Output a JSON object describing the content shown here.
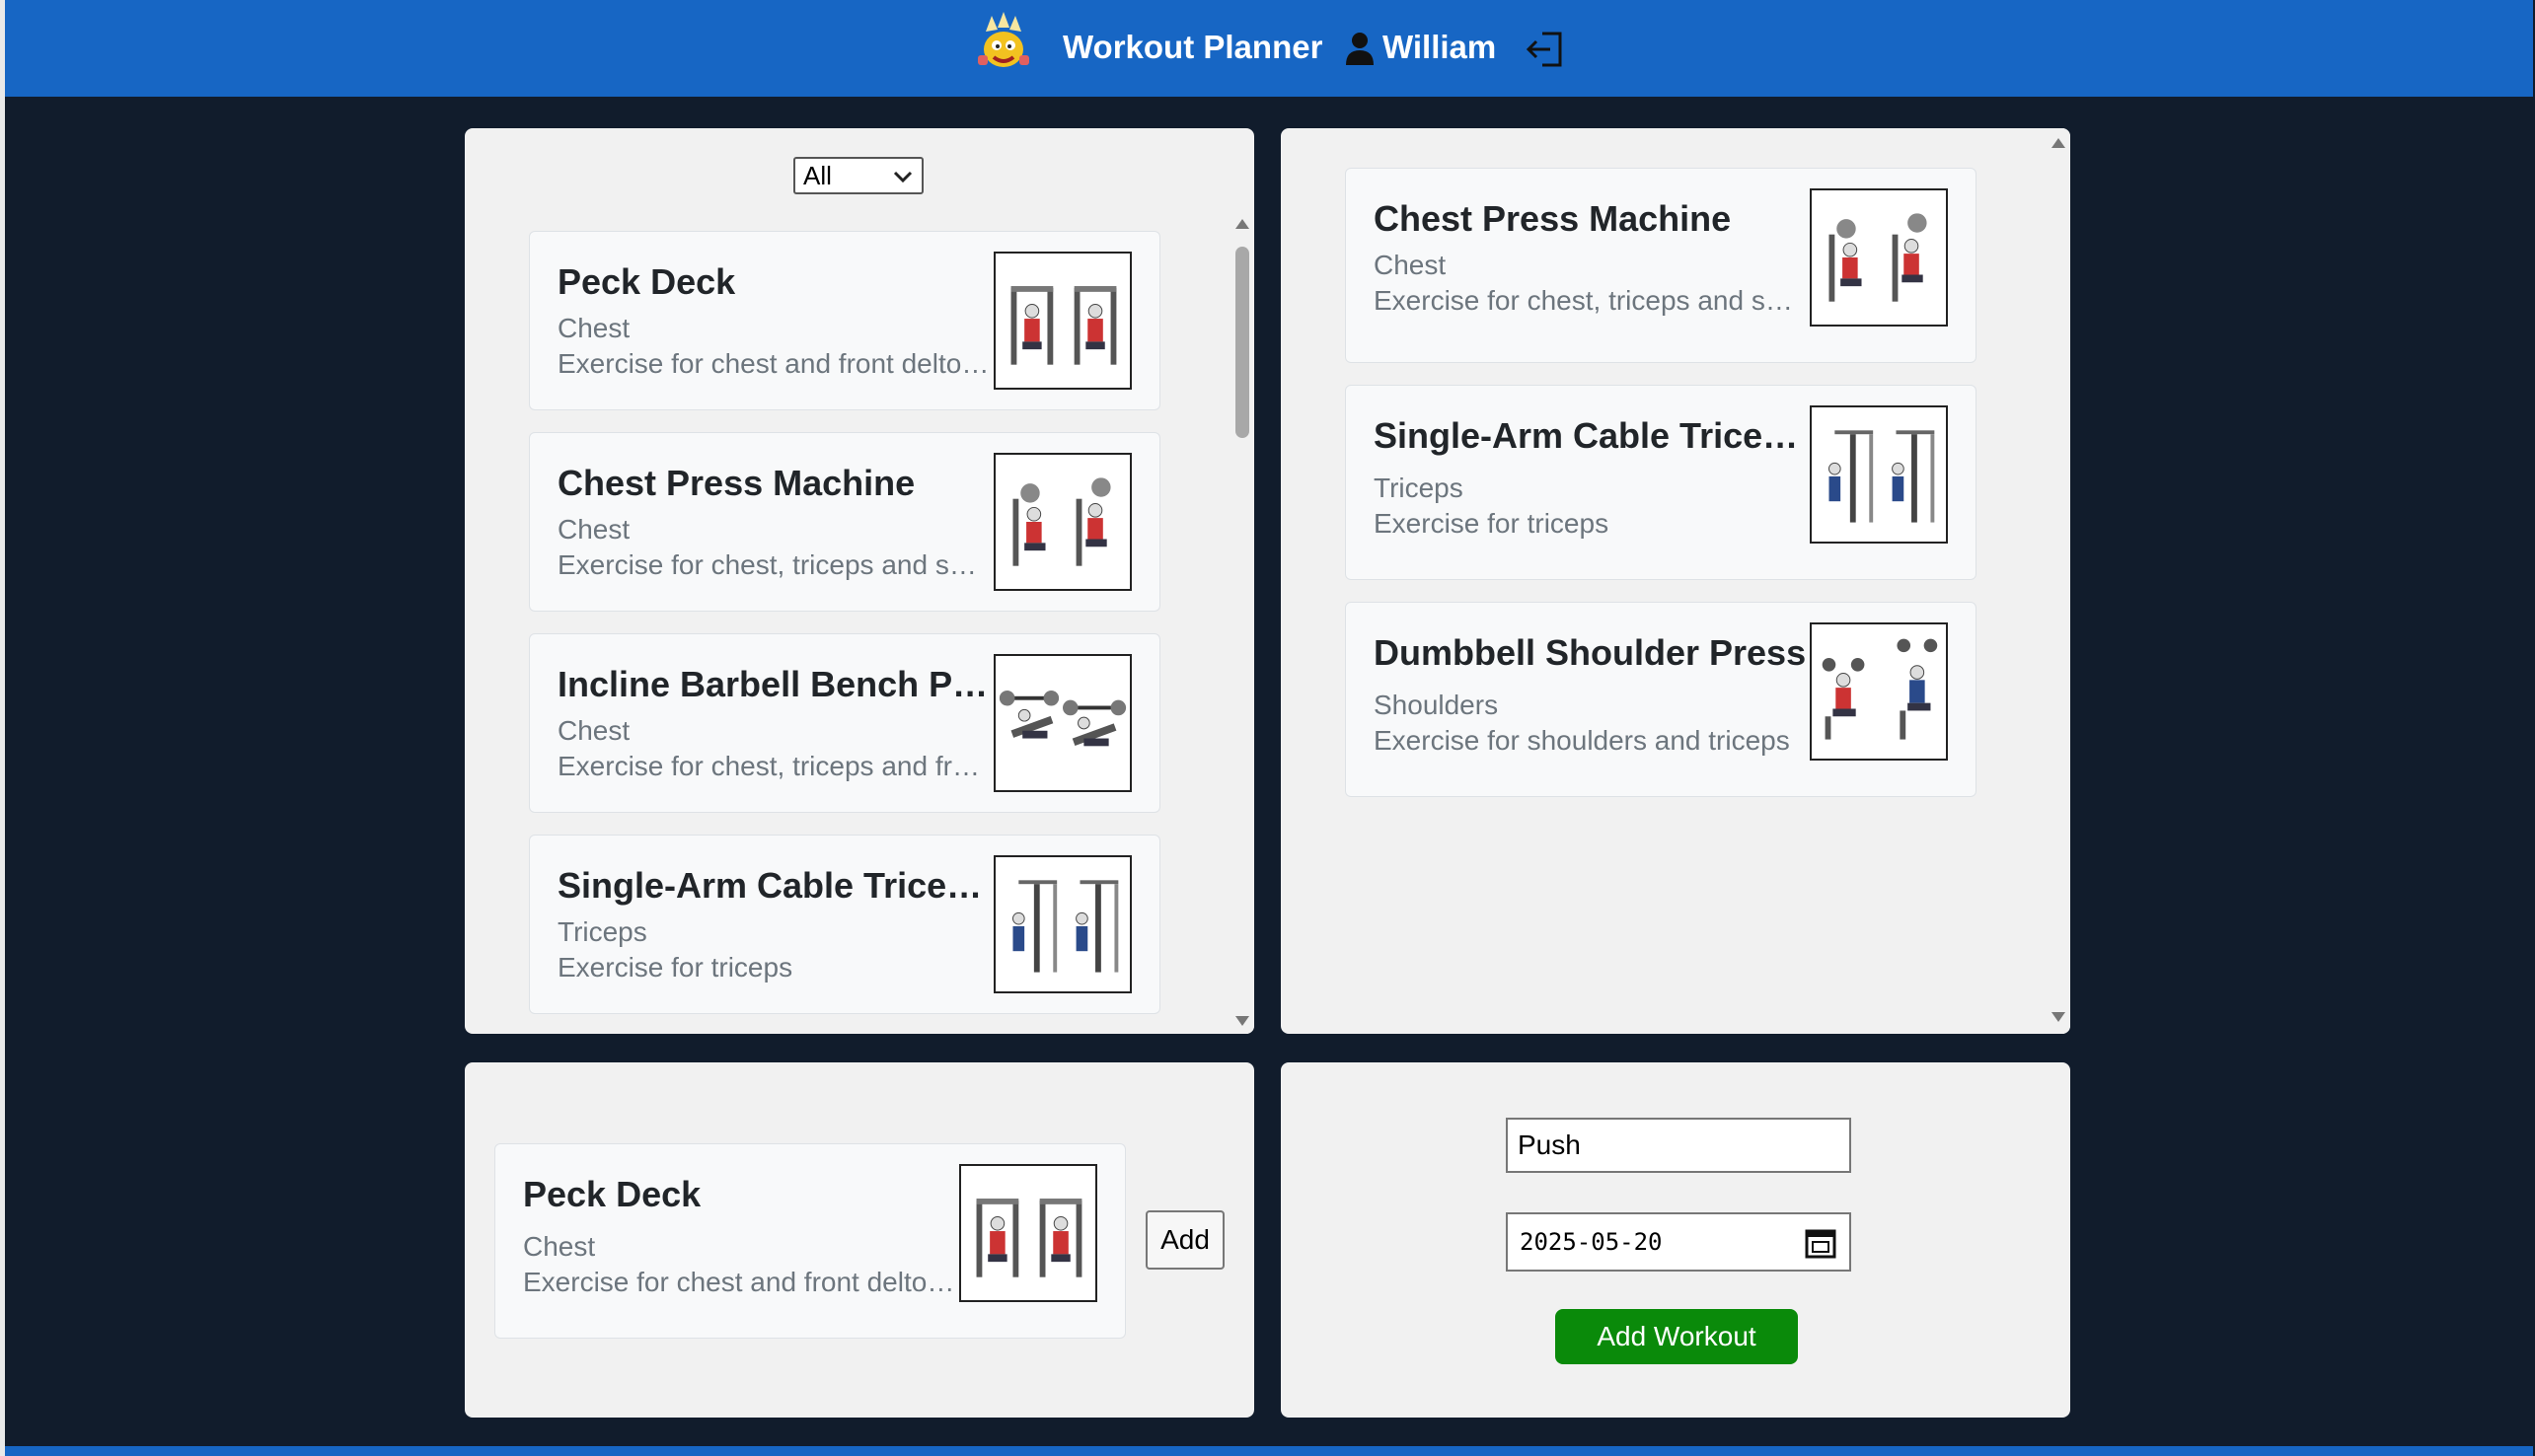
{
  "header": {
    "title": "Workout Planner",
    "user_name": "William",
    "logo_icon": "mascot-logo-icon",
    "user_icon": "user-icon",
    "logout_icon": "logout-icon"
  },
  "filter": {
    "selected": "All"
  },
  "exercise_list": [
    {
      "title": "Peck Deck",
      "category": "Chest",
      "description": "Exercise for chest and front deltoids",
      "thumbnail": "peck-deck-illustration"
    },
    {
      "title": "Chest Press Machine",
      "category": "Chest",
      "description": "Exercise for chest, triceps and shoulders",
      "thumbnail": "chest-press-illustration"
    },
    {
      "title": "Incline Barbell Bench Press",
      "category": "Chest",
      "description": "Exercise for chest, triceps and front deltoids",
      "thumbnail": "incline-bench-illustration"
    },
    {
      "title": "Single-Arm Cable Triceps Extension",
      "category": "Triceps",
      "description": "Exercise for triceps",
      "thumbnail": "cable-triceps-illustration"
    }
  ],
  "workout_list": [
    {
      "title": "Chest Press Machine",
      "category": "Chest",
      "description": "Exercise for chest, triceps and shoulders",
      "thumbnail": "chest-press-illustration"
    },
    {
      "title": "Single-Arm Cable Triceps Extension",
      "category": "Triceps",
      "description": "Exercise for triceps",
      "thumbnail": "cable-triceps-illustration"
    },
    {
      "title": "Dumbbell Shoulder Press",
      "category": "Shoulders",
      "description": "Exercise for shoulders and triceps",
      "thumbnail": "shoulder-press-illustration"
    }
  ],
  "selected_exercise": {
    "title": "Peck Deck",
    "category": "Chest",
    "description": "Exercise for chest and front deltoids",
    "thumbnail": "peck-deck-illustration",
    "add_label": "Add"
  },
  "workout_form": {
    "name_value": "Push",
    "date_value": "2025-05-20",
    "submit_label": "Add Workout"
  },
  "colors": {
    "header_bg": "#1766c4",
    "page_bg": "#111c2c",
    "panel_bg": "#f1f1f1",
    "submit_bg": "#0a8a0a"
  }
}
